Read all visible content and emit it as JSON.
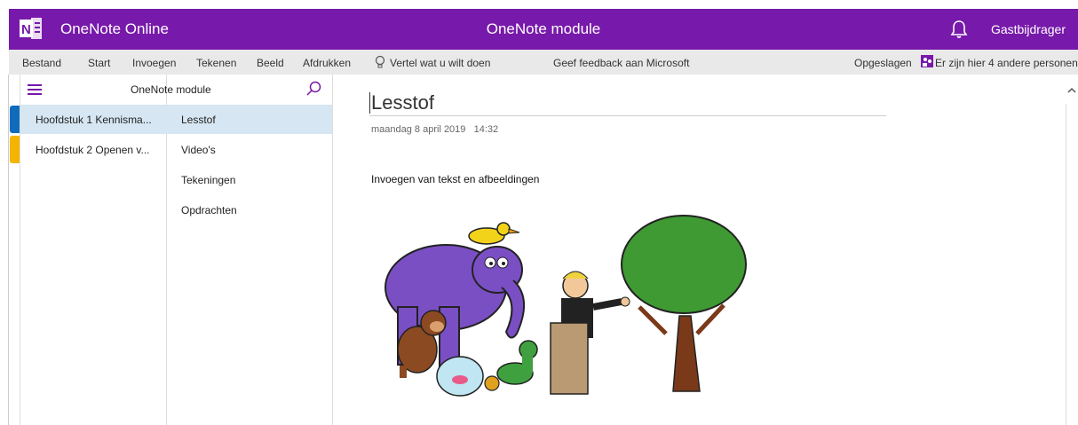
{
  "topbar": {
    "app_name": "OneNote Online",
    "center_title": "OneNote module",
    "user": "Gastbijdrager",
    "accent": "#7719aa"
  },
  "ribbon": {
    "menu": [
      "Bestand",
      "Start",
      "Invoegen",
      "Tekenen",
      "Beeld",
      "Afdrukken"
    ],
    "tell_me": "Vertel wat u wilt doen",
    "feedback": "Geef feedback aan Microsoft",
    "status": "Opgeslagen",
    "people": "Er zijn hier 4 andere personen"
  },
  "navigation": {
    "notebook_title": "OneNote module",
    "sections": [
      {
        "label": "Hoofdstuk 1 Kennisma...",
        "color": "#0f6cbd"
      },
      {
        "label": "Hoofdstuk 2 Openen v...",
        "color": "#f5b400"
      }
    ],
    "pages": [
      "Lesstof",
      "Video's",
      "Tekeningen",
      "Opdrachten"
    ]
  },
  "page": {
    "title": "Lesstof",
    "date": "maandag 8 april 2019",
    "time": "14:32",
    "body": "Invoegen van tekst en afbeeldingen"
  },
  "icons": {
    "logo": "onenote-logo-icon",
    "bell": "bell-icon",
    "hamburger": "hamburger-icon",
    "search": "search-icon",
    "lightbulb": "lightbulb-icon",
    "share": "people-icon",
    "scroll_up": "chevron-up-icon"
  }
}
